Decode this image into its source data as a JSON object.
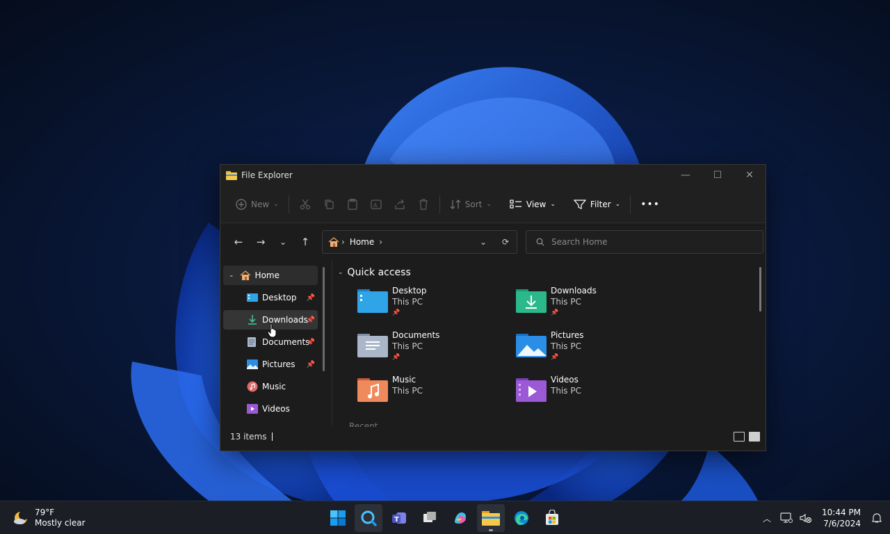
{
  "window": {
    "title": "File Explorer",
    "controls": {
      "minimize": "—",
      "maximize": "☐",
      "close": "✕"
    }
  },
  "toolbar": {
    "new_label": "New",
    "sort_label": "Sort",
    "view_label": "View",
    "filter_label": "Filter",
    "more_label": "•••"
  },
  "navigation": {
    "back": "←",
    "forward": "→",
    "recent": "⌄",
    "up": "↑",
    "breadcrumb": [
      "Home"
    ],
    "search_placeholder": "Search Home"
  },
  "sidebar": {
    "items": [
      {
        "label": "Home",
        "expanded": true
      },
      {
        "label": "Desktop",
        "pinned": true
      },
      {
        "label": "Downloads",
        "pinned": true,
        "selected": true
      },
      {
        "label": "Documents",
        "pinned": true
      },
      {
        "label": "Pictures",
        "pinned": true
      },
      {
        "label": "Music",
        "pinned": false
      },
      {
        "label": "Videos",
        "pinned": false
      }
    ]
  },
  "content": {
    "section_title": "Quick access",
    "tiles": [
      {
        "name": "Desktop",
        "location": "This PC",
        "pinned": true
      },
      {
        "name": "Downloads",
        "location": "This PC",
        "pinned": true
      },
      {
        "name": "Documents",
        "location": "This PC",
        "pinned": true
      },
      {
        "name": "Pictures",
        "location": "This PC",
        "pinned": true
      },
      {
        "name": "Music",
        "location": "This PC",
        "pinned": false
      },
      {
        "name": "Videos",
        "location": "This PC",
        "pinned": false
      }
    ],
    "next_section_peek": "Recent"
  },
  "status": {
    "items_count": "13 items"
  },
  "taskbar": {
    "weather_temp": "79°F",
    "weather_desc": "Mostly clear",
    "time": "10:44 PM",
    "date": "7/6/2024",
    "apps": [
      "start-icon",
      "search-icon",
      "teams-icon",
      "task-view-icon",
      "copilot-icon",
      "file-explorer-icon",
      "edge-icon",
      "store-icon"
    ]
  },
  "colors": {
    "accent": "#0078d4",
    "window_bg": "#1c1c1c",
    "taskbar_bg": "#1b1e24"
  }
}
